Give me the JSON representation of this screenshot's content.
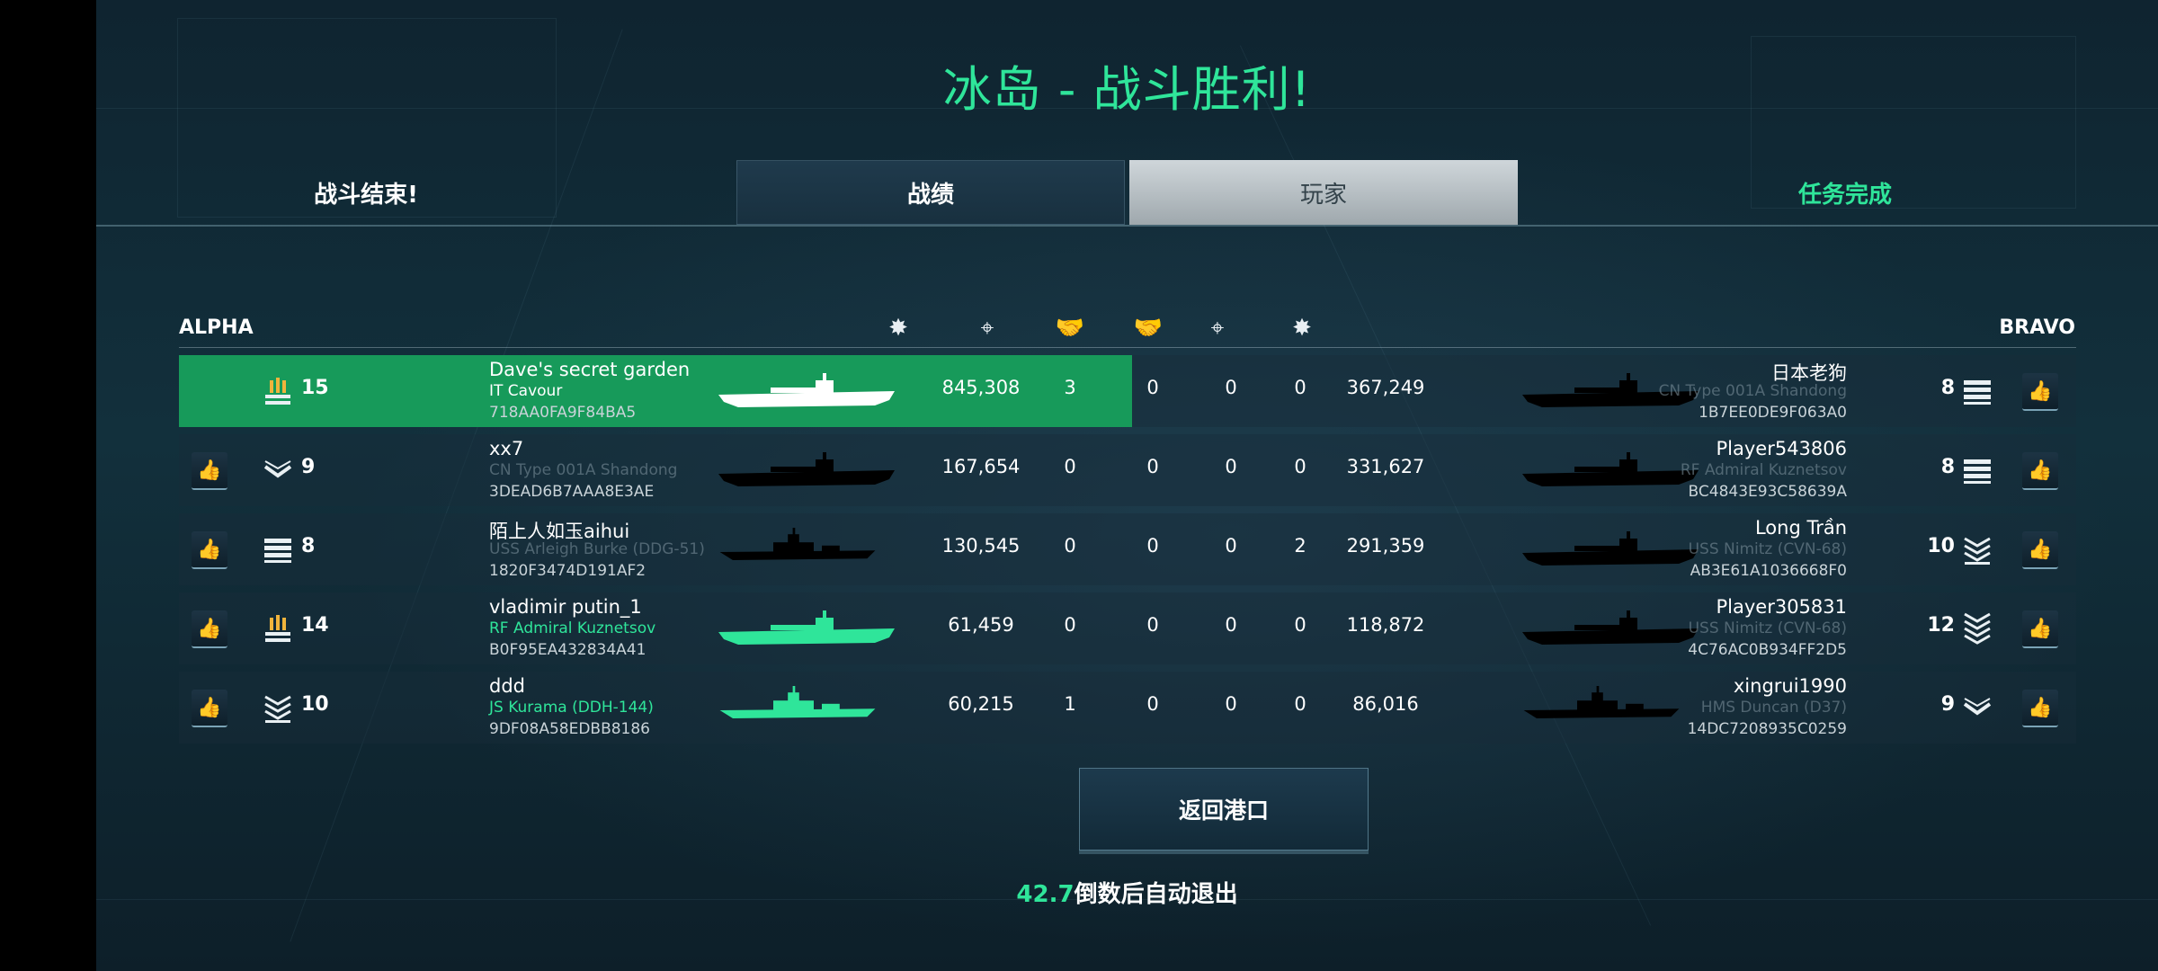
{
  "title": "冰岛 - 战斗胜利!",
  "tabs": {
    "battle_end": "战斗结束!",
    "stats": "战绩",
    "players": "玩家",
    "missions": "任务完成"
  },
  "teams": {
    "alpha": "ALPHA",
    "bravo": "BRAVO"
  },
  "columns": [
    "damage-icon",
    "crosshair-icon",
    "handshake-icon",
    "handshake-icon",
    "crosshair-icon",
    "damage-icon"
  ],
  "colors": {
    "accent": "#2fe59a",
    "highlight_row": "#179a5a"
  },
  "rows": [
    {
      "alpha": {
        "rank_icon": "medal-gold-icon",
        "level": "15",
        "name": "Dave's secret garden",
        "ship": "IT Cavour",
        "id": "718AA0FA9F84BA5",
        "damage": "845,308",
        "kills": "3",
        "assists": "0"
      },
      "bravo": {
        "assists": "0",
        "kills": "0",
        "damage": "367,249",
        "name": "日本老狗",
        "ship": "CN Type 001A Shandong",
        "id": "1B7EE0DE9F063A0",
        "level": "8",
        "rank_icon": "bars-rank-icon"
      }
    },
    {
      "alpha": {
        "rank_icon": "chevron-rank-icon",
        "level": "9",
        "name": "xx7",
        "ship": "CN Type 001A Shandong",
        "id": "3DEAD6B7AAA8E3AE",
        "damage": "167,654",
        "kills": "0",
        "assists": "0"
      },
      "bravo": {
        "assists": "0",
        "kills": "0",
        "damage": "331,627",
        "name": "Player543806",
        "ship": "RF Admiral Kuznetsov",
        "id": "BC4843E93C58639A",
        "level": "8",
        "rank_icon": "bars-rank-icon"
      }
    },
    {
      "alpha": {
        "rank_icon": "bars-rank-icon",
        "level": "8",
        "name": "陌上人如玉aihui",
        "ship": "USS Arleigh Burke (DDG-51)",
        "id": "1820F3474D191AF2",
        "damage": "130,545",
        "kills": "0",
        "assists": "0"
      },
      "bravo": {
        "assists": "0",
        "kills": "2",
        "damage": "291,359",
        "name": "Long Trần",
        "ship": "USS Nimitz (CVN-68)",
        "id": "AB3E61A1036668F0",
        "level": "10",
        "rank_icon": "double-chevron-rank-icon"
      }
    },
    {
      "alpha": {
        "rank_icon": "medal-gold-icon",
        "level": "14",
        "name": "vladimir putin_1",
        "ship": "RF Admiral Kuznetsov",
        "id": "B0F95EA432834A41",
        "damage": "61,459",
        "kills": "0",
        "assists": "0"
      },
      "bravo": {
        "assists": "0",
        "kills": "0",
        "damage": "118,872",
        "name": "Player305831",
        "ship": "USS Nimitz (CVN-68)",
        "id": "4C76AC0B934FF2D5",
        "level": "12",
        "rank_icon": "triple-chevron-rank-icon"
      }
    },
    {
      "alpha": {
        "rank_icon": "double-chevron-rank-icon",
        "level": "10",
        "name": "ddd",
        "ship": "JS Kurama (DDH-144)",
        "id": "9DF08A58EDBB8186",
        "damage": "60,215",
        "kills": "1",
        "assists": "0"
      },
      "bravo": {
        "assists": "0",
        "kills": "0",
        "damage": "86,016",
        "name": "xingrui1990",
        "ship": "HMS Duncan (D37)",
        "id": "14DC7208935C0259",
        "level": "9",
        "rank_icon": "chevron-rank-icon"
      }
    }
  ],
  "return_button": "返回港口",
  "countdown": {
    "seconds": "42.7",
    "text": "倒数后自动退出"
  }
}
